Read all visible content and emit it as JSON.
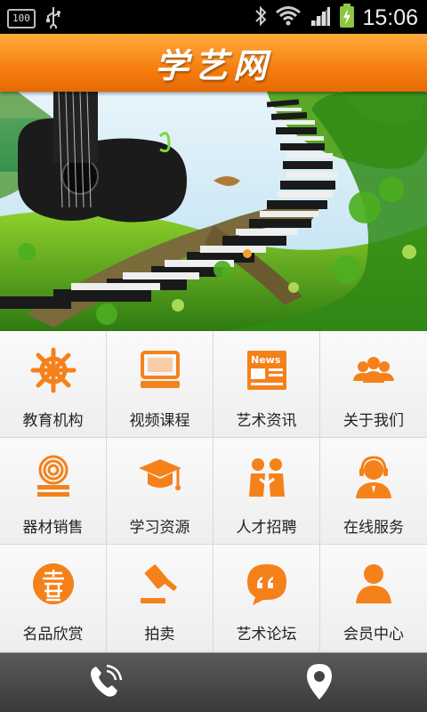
{
  "status_bar": {
    "battery_box": "100",
    "time": "15:06"
  },
  "header": {
    "title": "学艺网"
  },
  "banner": {
    "slide_count": 5,
    "active_index": 1
  },
  "menu": [
    {
      "label": "教育机构",
      "icon": "ship-wheel-icon"
    },
    {
      "label": "视频课程",
      "icon": "computer-icon"
    },
    {
      "label": "艺术资讯",
      "icon": "news-icon"
    },
    {
      "label": "关于我们",
      "icon": "people-group-icon"
    },
    {
      "label": "器材销售",
      "icon": "coiled-wire-icon"
    },
    {
      "label": "学习资源",
      "icon": "graduation-cap-icon"
    },
    {
      "label": "人才招聘",
      "icon": "recruit-people-icon"
    },
    {
      "label": "在线服务",
      "icon": "headset-agent-icon"
    },
    {
      "label": "名品欣赏",
      "icon": "seal-icon"
    },
    {
      "label": "拍卖",
      "icon": "gavel-icon"
    },
    {
      "label": "艺术论坛",
      "icon": "speech-bubble-icon"
    },
    {
      "label": "会员中心",
      "icon": "user-icon"
    }
  ],
  "colors": {
    "accent": "#f67b0c",
    "icon": "#f5811a"
  }
}
